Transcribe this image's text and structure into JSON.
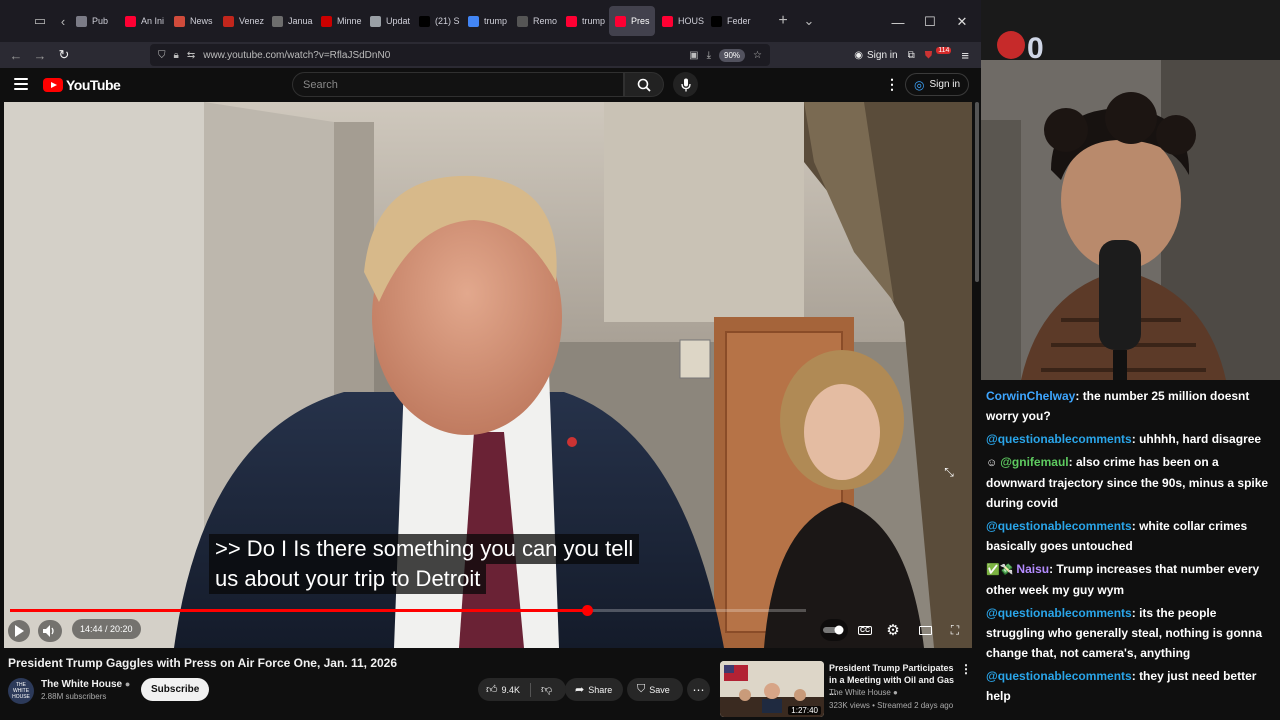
{
  "browser": {
    "tabs": [
      {
        "label": "Pub",
        "favicon_color": "#7b7b86",
        "active": false
      },
      {
        "label": "An Ini",
        "favicon_color": "#ff0033",
        "active": false
      },
      {
        "label": "News",
        "favicon_color": "#d04b3b",
        "active": false
      },
      {
        "label": "Venez",
        "favicon_color": "#c2261c",
        "active": false
      },
      {
        "label": "Janua",
        "favicon_color": "#6d6d6d",
        "active": false
      },
      {
        "label": "Minne",
        "favicon_color": "#cc0000",
        "active": false
      },
      {
        "label": "Updat",
        "favicon_color": "#9aa0a6",
        "active": false
      },
      {
        "label": "(21) S",
        "favicon_color": "#000000",
        "active": false
      },
      {
        "label": "trump",
        "favicon_color": "#4285f4",
        "active": false
      },
      {
        "label": "Remo",
        "favicon_color": "#555555",
        "active": false
      },
      {
        "label": "trump",
        "favicon_color": "#ff0033",
        "active": false
      },
      {
        "label": "Pres",
        "favicon_color": "#ff0033",
        "active": true
      },
      {
        "label": "HOUS",
        "favicon_color": "#ff0033",
        "active": false
      },
      {
        "label": "Feder",
        "favicon_color": "#000000",
        "active": false
      }
    ],
    "url": "www.youtube.com/watch?v=RflaJSdDnN0",
    "zoom": "90%",
    "sign_in": "Sign in",
    "notif_count": "114"
  },
  "youtube": {
    "logo_text": "YouTube",
    "search_placeholder": "Search",
    "sign_in": "Sign in",
    "captions": [
      ">> Do I Is there something you can you tell",
      "us about your trip to Detroit"
    ],
    "time_display": "14:44 / 20:20",
    "progress_fraction": 0.725,
    "video_title": "President Trump Gaggles with Press on Air Force One, Jan. 11, 2026",
    "channel_name": "The White House",
    "channel_subs": "2.88M subscribers",
    "channel_avatar_text": "THE WHITE HOUSE",
    "subscribe_label": "Subscribe",
    "like_count": "9.4K",
    "share_label": "Share",
    "save_label": "Save",
    "recommended": {
      "title": "President Trump Participates in a Meeting with Oil and Gas ...",
      "channel": "The White House",
      "meta": "323K views • Streamed 2 days ago",
      "duration": "1:27:40"
    }
  },
  "chat": {
    "messages": [
      {
        "user": "CorwinChelway",
        "user_color": "#3ea6ff",
        "badge": "",
        "text": ": the number 25 million doesnt worry you?"
      },
      {
        "user": "@questionablecomments",
        "user_color": "#2aa5e9",
        "badge": "",
        "text": ": uhhhh, hard disagree"
      },
      {
        "user": "@gnifemaul",
        "user_color": "#5ecb60",
        "badge": "☺",
        "text": ": also crime has been on a downward trajectory since the 90s, minus a spike during covid"
      },
      {
        "user": "@questionablecomments",
        "user_color": "#2aa5e9",
        "badge": "",
        "text": ": white collar crimes basically goes untouched"
      },
      {
        "user": "Naisu",
        "user_color": "#b48cff",
        "badge": "✅💸",
        "text": ": Trump increases that number every other week my guy wym"
      },
      {
        "user": "@questionablecomments",
        "user_color": "#2aa5e9",
        "badge": "",
        "text": ": its the people struggling who generally steal, nothing is gonna change that, not camera's, anything"
      },
      {
        "user": "@questionablecomments",
        "user_color": "#2aa5e9",
        "badge": "",
        "text": ": they just need better help"
      }
    ]
  }
}
